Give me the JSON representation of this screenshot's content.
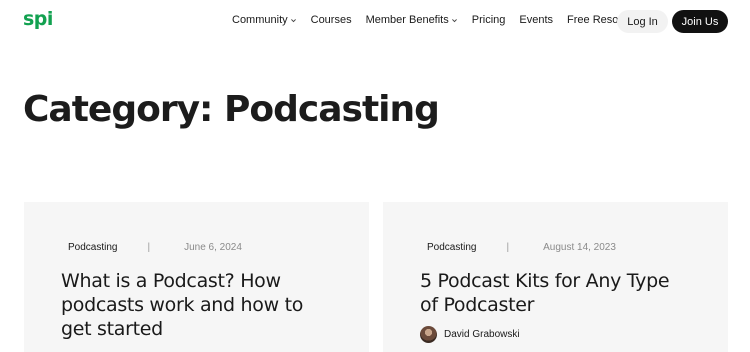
{
  "logo": {
    "text": "spi"
  },
  "nav": {
    "items": [
      {
        "label": "Community",
        "dropdown": true
      },
      {
        "label": "Courses",
        "dropdown": false
      },
      {
        "label": "Member Benefits",
        "dropdown": true
      },
      {
        "label": "Pricing",
        "dropdown": false
      },
      {
        "label": "Events",
        "dropdown": false
      },
      {
        "label": "Free Resources",
        "dropdown": true
      }
    ],
    "login_label": "Log In",
    "join_label": "Join Us"
  },
  "page": {
    "title": "Category: Podcasting"
  },
  "posts": [
    {
      "category": "Podcasting",
      "date": "June 6, 2024",
      "title": "What is a Podcast? How podcasts work and how to get started"
    },
    {
      "category": "Podcasting",
      "date": "August 14, 2023",
      "title": "5 Podcast Kits for Any Type of Podcaster",
      "author": "David Grabowski"
    }
  ],
  "colors": {
    "brand": "#12a150",
    "join_button": "#111111",
    "card_bg": "#f6f6f6"
  }
}
